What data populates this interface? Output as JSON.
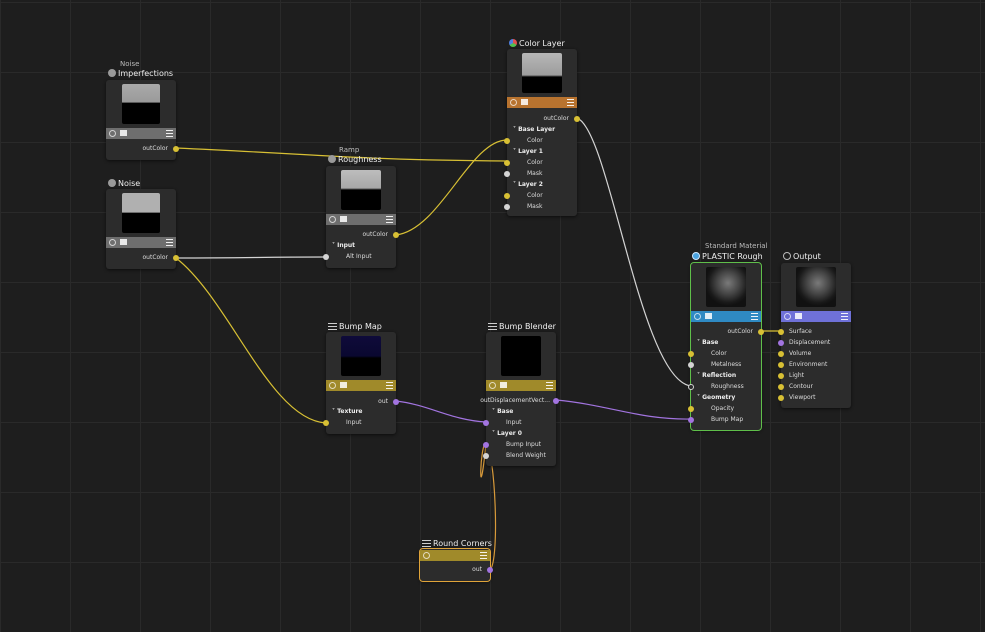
{
  "nodes": {
    "imperfections": {
      "subtitle": "Noise",
      "title": "Imperfections",
      "out": "outColor"
    },
    "noise": {
      "title": "Noise",
      "out": "outColor"
    },
    "roughness": {
      "subtitle": "Ramp",
      "title": "Roughness",
      "out": "outColor",
      "group_input": "Input",
      "alt_input": "Alt Input"
    },
    "color_layer": {
      "title": "Color Layer",
      "out": "outColor",
      "base_layer": "Base Layer",
      "color": "Color",
      "layer1": "Layer 1",
      "mask": "Mask",
      "layer2": "Layer 2"
    },
    "bump_map": {
      "title": "Bump Map",
      "out": "out",
      "group_texture": "Texture",
      "input": "Input"
    },
    "bump_blender": {
      "title": "Bump Blender",
      "out": "outDisplacementVect...",
      "group_base": "Base",
      "input": "Input",
      "layer0": "Layer 0",
      "bump_input": "Bump Input",
      "blend_weight": "Blend Weight"
    },
    "round_corners": {
      "title": "Round Corners",
      "out": "out"
    },
    "plastic": {
      "subtitle": "Standard Material",
      "title": "PLASTIC Rough",
      "out": "outColor",
      "group_base": "Base",
      "color": "Color",
      "metalness": "Metalness",
      "group_reflection": "Reflection",
      "roughness": "Roughness",
      "group_geometry": "Geometry",
      "opacity": "Opacity",
      "bump_map": "Bump Map"
    },
    "output": {
      "title": "Output",
      "surface": "Surface",
      "displacement": "Displacement",
      "volume": "Volume",
      "environment": "Environment",
      "light": "Light",
      "contour": "Contour",
      "viewport": "Viewport"
    }
  },
  "colors": {
    "yellow": "#d8c034",
    "purple": "#a274e0",
    "white": "#d4d4d4",
    "orange_bar": "#b8732f",
    "bump_bar": "#a08a2a",
    "texture_bar": "#6e6e6e",
    "material_bar": "#2f8ac3",
    "output_bar": "#6f71d8",
    "selected": "#5fbf4a"
  },
  "icons": [
    "node-type-icon",
    "image-icon",
    "menu-icon",
    "sphere-icon",
    "output-icon",
    "layers-icon",
    "texture-stack-icon"
  ]
}
